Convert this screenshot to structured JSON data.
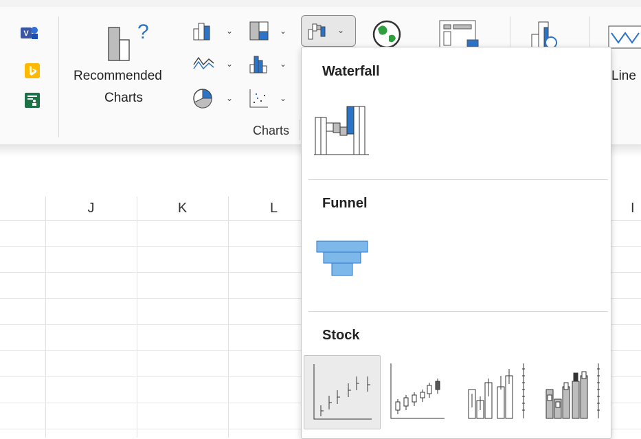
{
  "ribbon": {
    "recommended_charts_line1": "Recommended",
    "recommended_charts_line2": "Charts",
    "charts_group_label": "Charts",
    "line_sparkline_label": "Line"
  },
  "sheet": {
    "columns": [
      "J",
      "K",
      "L"
    ],
    "partial_column": "I"
  },
  "menu": {
    "sections": [
      {
        "title": "Waterfall",
        "items": [
          "waterfall-chart"
        ]
      },
      {
        "title": "Funnel",
        "items": [
          "funnel-chart"
        ]
      },
      {
        "title": "Stock",
        "items": [
          "high-low-close",
          "open-high-low-close",
          "volume-high-low-close",
          "volume-open-high-low-close"
        ]
      }
    ]
  },
  "colors": {
    "accent_blue": "#2b74c7",
    "funnel_blue": "#7cb8ea",
    "excel_green": "#1e7145"
  }
}
